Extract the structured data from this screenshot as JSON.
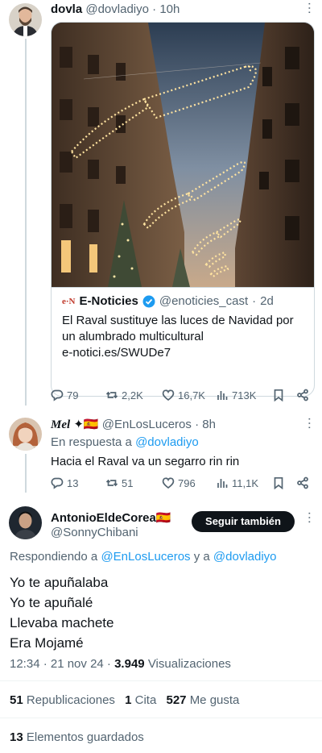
{
  "tweet1": {
    "name": "dovla",
    "handle": "@dovladiyo",
    "time": "10h",
    "card": {
      "source_logo": "e·N",
      "source_name": "E-Noticies",
      "source_handle": "@enoticies_cast",
      "source_time": "2d",
      "text_line1": "El Raval sustituye las luces de Navidad por",
      "text_line2": "un alumbrado multicultural",
      "text_line3": "e-notici.es/SWUDe7"
    },
    "actions": {
      "replies": "79",
      "retweets": "2,2K",
      "likes": "16,7K",
      "views": "713K"
    }
  },
  "tweet2": {
    "name": "Mel",
    "name_suffix": "✦🇪🇸",
    "handle": "@EnLosLuceros",
    "time": "8h",
    "reply_prefix": "En respuesta a",
    "reply_to": "@dovladiyo",
    "text": "Hacia el Raval va un segarro rin rin",
    "actions": {
      "replies": "13",
      "retweets": "51",
      "likes": "796",
      "views": "11,1K"
    }
  },
  "tweet3": {
    "name": "AntonioEldeCorea",
    "flag": "🇪🇸",
    "handle": "@SonnyChibani",
    "follow_button": "Seguir también",
    "reply_prefix": "Respondiendo a",
    "reply_to1": "@EnLosLuceros",
    "reply_and": "y a",
    "reply_to2": "@dovladiyo",
    "lines": [
      "Yo te apuñalaba",
      "Yo te apuñalé",
      "Llevaba machete",
      "Era Mojamé"
    ],
    "timestamp": "12:34 · 21 nov 24 ·",
    "views_count": "3.949",
    "views_label": "Visualizaciones",
    "reposts_count": "51",
    "reposts_label": "Republicaciones",
    "quotes_count": "1",
    "quotes_label": "Cita",
    "likes_count": "527",
    "likes_label": "Me gusta",
    "bookmarks_count": "13",
    "bookmarks_label": "Elementos guardados"
  },
  "colors": {
    "accent": "#1d9bf0",
    "muted": "#536471",
    "verified": "#1d9bf0"
  }
}
